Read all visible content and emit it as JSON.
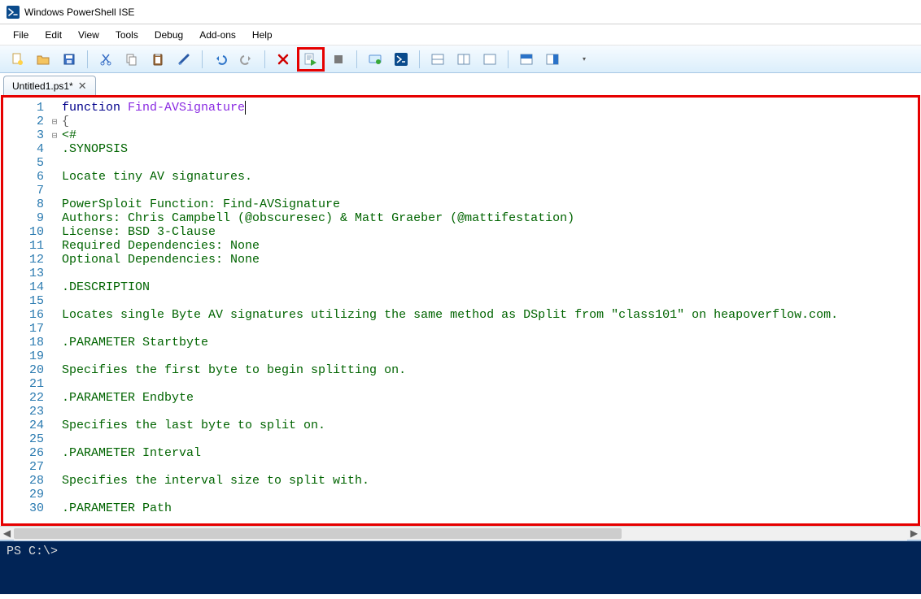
{
  "window": {
    "title": "Windows PowerShell ISE"
  },
  "menu": {
    "items": [
      "File",
      "Edit",
      "View",
      "Tools",
      "Debug",
      "Add-ons",
      "Help"
    ]
  },
  "toolbar": {
    "buttons": [
      {
        "name": "new-icon"
      },
      {
        "name": "open-icon"
      },
      {
        "name": "save-icon"
      },
      {
        "sep": true
      },
      {
        "name": "cut-icon"
      },
      {
        "name": "copy-icon"
      },
      {
        "name": "paste-icon"
      },
      {
        "name": "clear-icon"
      },
      {
        "sep": true
      },
      {
        "name": "undo-icon"
      },
      {
        "name": "redo-icon"
      },
      {
        "sep": true
      },
      {
        "name": "stop-red-icon"
      },
      {
        "name": "run-script-icon",
        "highlight": true
      },
      {
        "name": "stop-icon"
      },
      {
        "sep": true
      },
      {
        "name": "remote-icon"
      },
      {
        "name": "powershell-icon"
      },
      {
        "sep": true
      },
      {
        "name": "layout-a-icon"
      },
      {
        "name": "layout-b-icon"
      },
      {
        "name": "layout-c-icon"
      },
      {
        "sep": true
      },
      {
        "name": "show-script-icon"
      },
      {
        "name": "show-command-icon"
      },
      {
        "name": "dropdown-icon",
        "drop": true
      }
    ]
  },
  "tab": {
    "label": "Untitled1.ps1*",
    "close": "✕"
  },
  "editor": {
    "lines": [
      {
        "n": 1,
        "fold": "",
        "segs": [
          {
            "t": "function ",
            "c": "kw"
          },
          {
            "t": "Find-AVSignature",
            "c": "fn cursor"
          }
        ]
      },
      {
        "n": 2,
        "fold": "⊟",
        "segs": [
          {
            "t": "{",
            "c": "op"
          }
        ]
      },
      {
        "n": 3,
        "fold": "⊟",
        "segs": [
          {
            "t": "<#",
            "c": ""
          }
        ]
      },
      {
        "n": 4,
        "fold": "",
        "segs": [
          {
            "t": ".SYNOPSIS",
            "c": ""
          }
        ]
      },
      {
        "n": 5,
        "fold": "",
        "segs": [
          {
            "t": "",
            "c": ""
          }
        ]
      },
      {
        "n": 6,
        "fold": "",
        "segs": [
          {
            "t": "Locate tiny AV signatures.",
            "c": ""
          }
        ]
      },
      {
        "n": 7,
        "fold": "",
        "segs": [
          {
            "t": "",
            "c": ""
          }
        ]
      },
      {
        "n": 8,
        "fold": "",
        "segs": [
          {
            "t": "PowerSploit Function: Find-AVSignature",
            "c": ""
          }
        ]
      },
      {
        "n": 9,
        "fold": "",
        "segs": [
          {
            "t": "Authors: Chris Campbell (@obscuresec) & Matt Graeber (@mattifestation)",
            "c": ""
          }
        ]
      },
      {
        "n": 10,
        "fold": "",
        "segs": [
          {
            "t": "License: BSD 3-Clause",
            "c": ""
          }
        ]
      },
      {
        "n": 11,
        "fold": "",
        "segs": [
          {
            "t": "Required Dependencies: None",
            "c": ""
          }
        ]
      },
      {
        "n": 12,
        "fold": "",
        "segs": [
          {
            "t": "Optional Dependencies: None",
            "c": ""
          }
        ]
      },
      {
        "n": 13,
        "fold": "",
        "segs": [
          {
            "t": "",
            "c": ""
          }
        ]
      },
      {
        "n": 14,
        "fold": "",
        "segs": [
          {
            "t": ".DESCRIPTION",
            "c": ""
          }
        ]
      },
      {
        "n": 15,
        "fold": "",
        "segs": [
          {
            "t": "",
            "c": ""
          }
        ]
      },
      {
        "n": 16,
        "fold": "",
        "segs": [
          {
            "t": "Locates single Byte AV signatures utilizing the same method as DSplit from \"class101\" on heapoverflow.com.",
            "c": ""
          }
        ]
      },
      {
        "n": 17,
        "fold": "",
        "segs": [
          {
            "t": "",
            "c": ""
          }
        ]
      },
      {
        "n": 18,
        "fold": "",
        "segs": [
          {
            "t": ".PARAMETER Startbyte",
            "c": ""
          }
        ]
      },
      {
        "n": 19,
        "fold": "",
        "segs": [
          {
            "t": "",
            "c": ""
          }
        ]
      },
      {
        "n": 20,
        "fold": "",
        "segs": [
          {
            "t": "Specifies the first byte to begin splitting on.",
            "c": ""
          }
        ]
      },
      {
        "n": 21,
        "fold": "",
        "segs": [
          {
            "t": "",
            "c": ""
          }
        ]
      },
      {
        "n": 22,
        "fold": "",
        "segs": [
          {
            "t": ".PARAMETER Endbyte",
            "c": ""
          }
        ]
      },
      {
        "n": 23,
        "fold": "",
        "segs": [
          {
            "t": "",
            "c": ""
          }
        ]
      },
      {
        "n": 24,
        "fold": "",
        "segs": [
          {
            "t": "Specifies the last byte to split on.",
            "c": ""
          }
        ]
      },
      {
        "n": 25,
        "fold": "",
        "segs": [
          {
            "t": "",
            "c": ""
          }
        ]
      },
      {
        "n": 26,
        "fold": "",
        "segs": [
          {
            "t": ".PARAMETER Interval",
            "c": ""
          }
        ]
      },
      {
        "n": 27,
        "fold": "",
        "segs": [
          {
            "t": "",
            "c": ""
          }
        ]
      },
      {
        "n": 28,
        "fold": "",
        "segs": [
          {
            "t": "Specifies the interval size to split with.",
            "c": ""
          }
        ]
      },
      {
        "n": 29,
        "fold": "",
        "segs": [
          {
            "t": "",
            "c": ""
          }
        ]
      },
      {
        "n": 30,
        "fold": "",
        "segs": [
          {
            "t": ".PARAMETER Path",
            "c": ""
          }
        ]
      }
    ]
  },
  "console": {
    "prompt": "PS C:\\> "
  }
}
